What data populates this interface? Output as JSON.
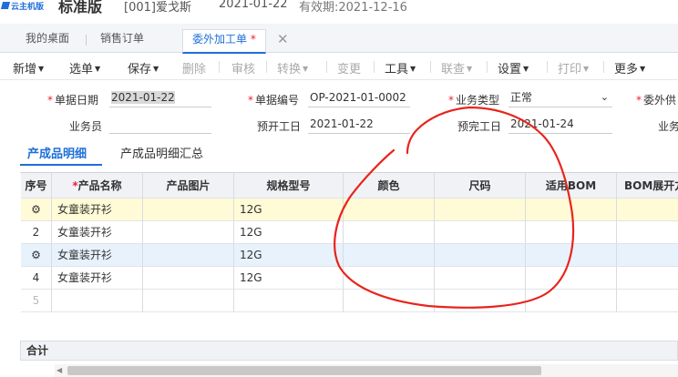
{
  "app": {
    "logo_text": "云主机版",
    "edition": "标准版",
    "company": "[001]爱戈斯",
    "date": "2021-01-22",
    "valid_until": "有效期:2021-12-16"
  },
  "tabs": [
    {
      "label": "我的桌面"
    },
    {
      "label": "销售订单"
    },
    {
      "label": "委外加工单",
      "modified": "*"
    }
  ],
  "toolbar": {
    "new": "新增",
    "select": "选单",
    "save": "保存",
    "delete": "删除",
    "audit": "审核",
    "convert": "转换",
    "change": "变更",
    "tools": "工具",
    "query": "联查",
    "settings": "设置",
    "print": "打印",
    "more": "更多"
  },
  "form": {
    "doc_date_label": "单据日期",
    "doc_date": "2021-01-22",
    "doc_no_label": "单据编号",
    "doc_no": "OP-2021-01-0002",
    "biz_type_label": "业务类型",
    "biz_type": "正常",
    "outsource_label": "委外供",
    "salesman_label": "业务员",
    "start_label": "预开工日",
    "start_date": "2021-01-22",
    "finish_label": "预完工日",
    "finish_date": "2021-01-24",
    "cut_label": "业务"
  },
  "subtabs": [
    "产成品明细",
    "产成品明细汇总"
  ],
  "grid": {
    "headers": [
      "序号",
      "产品名称",
      "产品图片",
      "规格型号",
      "颜色",
      "尺码",
      "适用BOM",
      "BOM展开方"
    ],
    "rows": [
      {
        "seq": "",
        "name": "女童装开衫",
        "spec": "12G"
      },
      {
        "seq": "2",
        "name": "女童装开衫",
        "spec": "12G"
      },
      {
        "seq": "",
        "name": "女童装开衫",
        "spec": "12G"
      },
      {
        "seq": "4",
        "name": "女童装开衫",
        "spec": "12G"
      },
      {
        "seq": "5",
        "name": "",
        "spec": ""
      }
    ]
  },
  "footer": {
    "total_label": "合计"
  },
  "colors": {
    "accent": "#1e6fd9",
    "annotation": "#e8241c"
  }
}
